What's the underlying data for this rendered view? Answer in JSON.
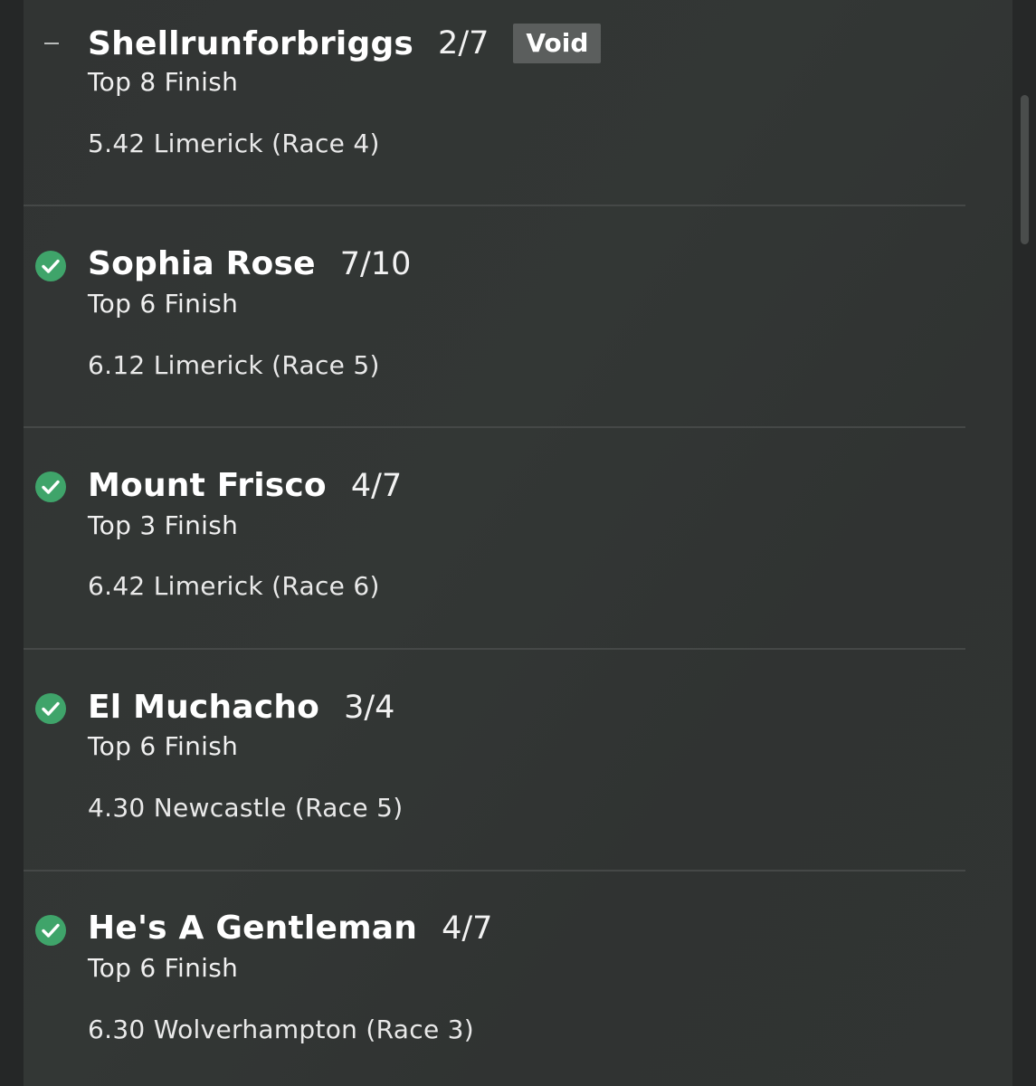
{
  "selections": [
    {
      "status": "void",
      "status_icon": "dash-icon",
      "runner": "Shellrunforbriggs",
      "odds": "2/7",
      "badge": "Void",
      "market": "Top 8 Finish",
      "event": "5.42 Limerick (Race 4)"
    },
    {
      "status": "won",
      "status_icon": "check-circle-icon",
      "runner": "Sophia Rose",
      "odds": "7/10",
      "market": "Top 6 Finish",
      "event": "6.12 Limerick (Race 5)"
    },
    {
      "status": "won",
      "status_icon": "check-circle-icon",
      "runner": "Mount Frisco",
      "odds": "4/7",
      "market": "Top 3 Finish",
      "event": "6.42 Limerick (Race 6)"
    },
    {
      "status": "won",
      "status_icon": "check-circle-icon",
      "runner": "El Muchacho",
      "odds": "3/4",
      "market": "Top 6 Finish",
      "event": "4.30 Newcastle (Race 5)"
    },
    {
      "status": "won",
      "status_icon": "check-circle-icon",
      "runner": "He's A Gentleman",
      "odds": "4/7",
      "market": "Top 6 Finish",
      "event": "6.30 Wolverhampton (Race 3)"
    }
  ],
  "colors": {
    "won": "#3fa46a",
    "void_badge": "#5b5e5d",
    "background": "#313433"
  }
}
